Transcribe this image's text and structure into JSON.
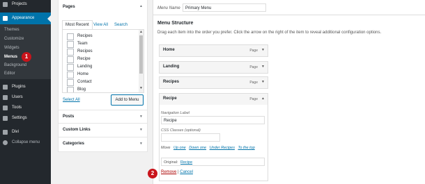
{
  "colors": {
    "sidebar_bg": "#23282d",
    "accent": "#0073aa",
    "badge": "#c9141b",
    "delete": "#a00"
  },
  "sidebar": {
    "top_items": [
      {
        "label": "Projects",
        "icon": "pin-icon"
      },
      {
        "label": "Appearance",
        "icon": "paintbrush-icon"
      }
    ],
    "submenu": [
      "Themes",
      "Customize",
      "Widgets",
      "Menus",
      "Background",
      "Editor"
    ],
    "bottom_items": [
      {
        "label": "Plugins",
        "icon": "plug-icon"
      },
      {
        "label": "Users",
        "icon": "users-icon"
      },
      {
        "label": "Tools",
        "icon": "wrench-icon"
      },
      {
        "label": "Settings",
        "icon": "settings-icon"
      },
      {
        "label": "Divi",
        "icon": "divi-icon"
      },
      {
        "label": "Collapse menu",
        "icon": "collapse-icon"
      }
    ]
  },
  "badges": [
    "1",
    "2"
  ],
  "left_panel": {
    "pages_title": "Pages",
    "tabs": [
      "Most Recent",
      "View All",
      "Search"
    ],
    "pages": [
      "Recipes",
      "Team",
      "Recipes",
      "Recipe",
      "Landing",
      "Home",
      "Contact",
      "Blog"
    ],
    "select_all": "Select All",
    "add_button": "Add to Menu",
    "sections": [
      "Posts",
      "Custom Links",
      "Categories"
    ]
  },
  "right_panel": {
    "menu_name_label": "Menu Name",
    "menu_name_value": "Primary Menu",
    "structure_title": "Menu Structure",
    "instructions": "Drag each item into the order you prefer. Click the arrow on the right of the item to reveal additional configuration options.",
    "items": [
      {
        "title": "Home",
        "kind": "Page"
      },
      {
        "title": "Landing",
        "kind": "Page"
      },
      {
        "title": "Recipes",
        "kind": "Page"
      },
      {
        "title": "Recipe",
        "kind": "Page"
      }
    ],
    "settings": {
      "nav_label": "Navigation Label",
      "nav_value": "Recipe",
      "css_label": "CSS Classes (optional)",
      "move_label": "Move",
      "move_links": [
        "Up one",
        "Down one",
        "Under Recipes",
        "To the top"
      ],
      "original_label": "Original:",
      "original_link": "Recipe",
      "remove": "Remove",
      "separator": "|",
      "cancel": "Cancel"
    }
  }
}
